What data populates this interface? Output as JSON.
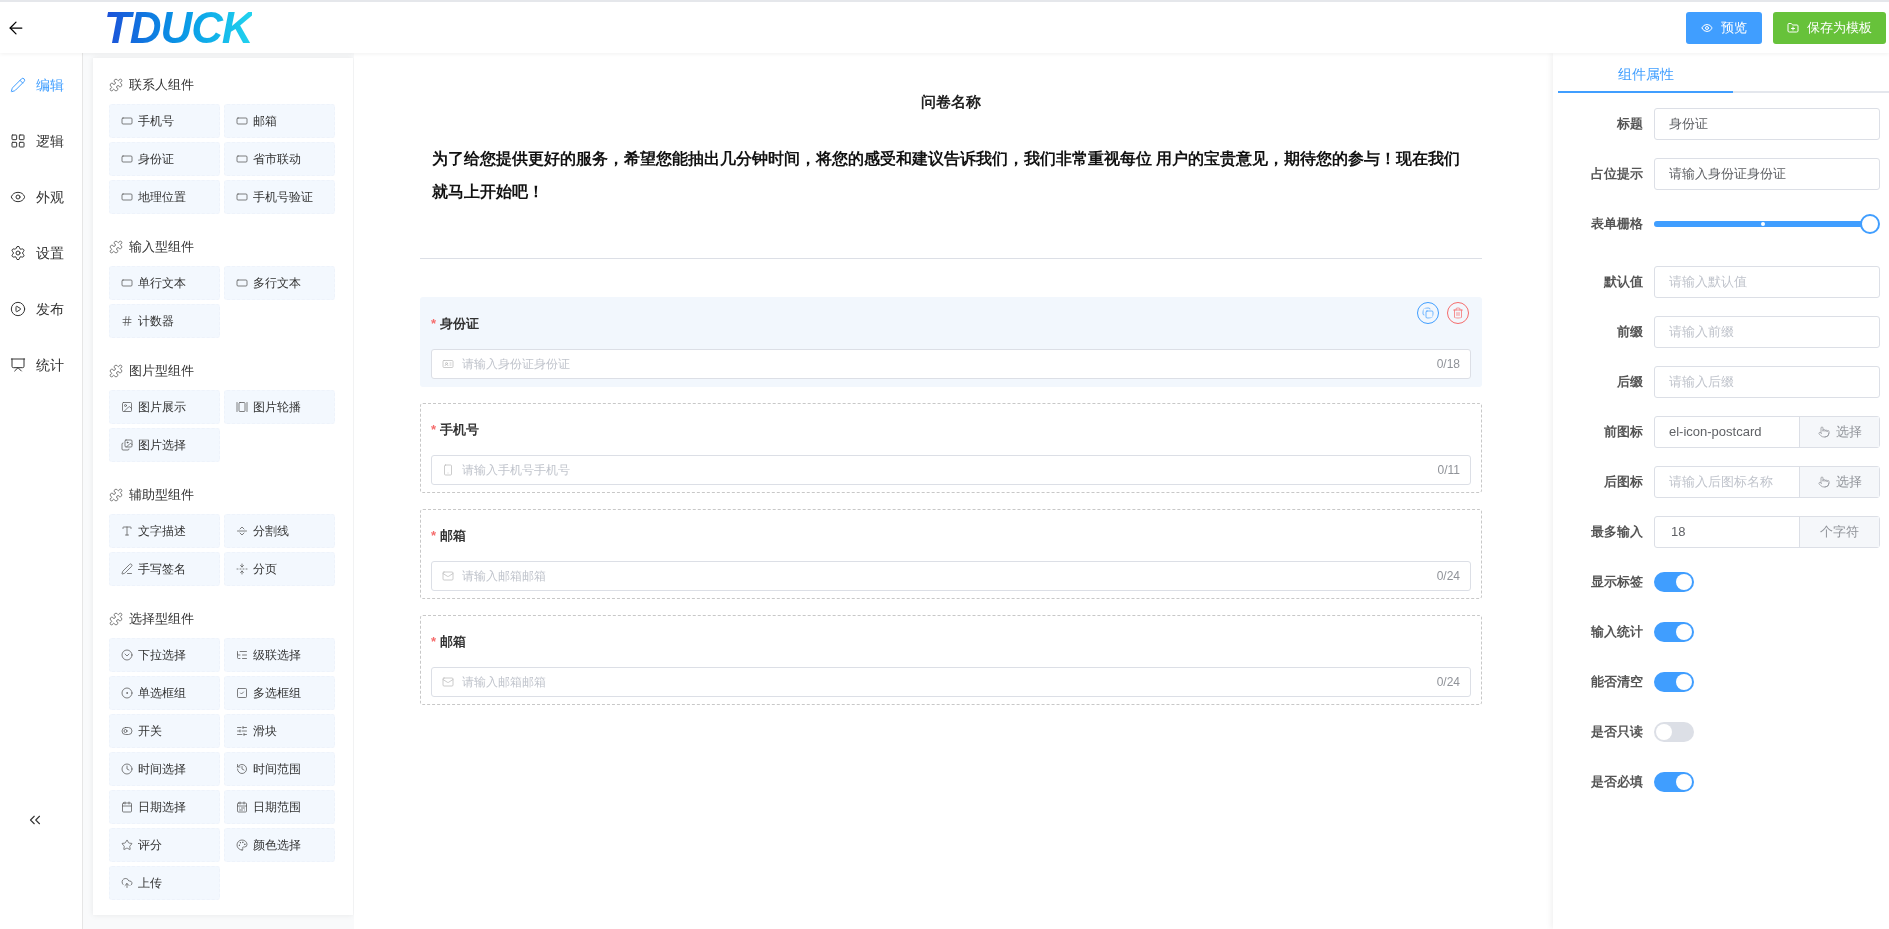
{
  "header": {
    "logo": "TDUCK",
    "buttons": [
      {
        "kind": "preview",
        "label": "预览"
      },
      {
        "kind": "save",
        "label": "保存为模板"
      }
    ]
  },
  "nav": [
    {
      "label": "编辑",
      "selected": true
    },
    {
      "label": "逻辑",
      "selected": false
    },
    {
      "label": "外观",
      "selected": false
    },
    {
      "label": "设置",
      "selected": false
    },
    {
      "label": "发布",
      "selected": false
    },
    {
      "label": "统计",
      "selected": false
    }
  ],
  "palette": [
    {
      "title": "联系人组件",
      "items": [
        "手机号",
        "邮箱",
        "身份证",
        "省市联动",
        "地理位置",
        "手机号验证"
      ]
    },
    {
      "title": "输入型组件",
      "items": [
        "单行文本",
        "多行文本",
        "计数器"
      ]
    },
    {
      "title": "图片型组件",
      "items": [
        "图片展示",
        "图片轮播",
        "图片选择"
      ]
    },
    {
      "title": "辅助型组件",
      "items": [
        "文字描述",
        "分割线",
        "手写签名",
        "分页"
      ]
    },
    {
      "title": "选择型组件",
      "items": [
        "下拉选择",
        "级联选择",
        "单选框组",
        "多选框组",
        "开关",
        "滑块",
        "时间选择",
        "时间范围",
        "日期选择",
        "日期范围",
        "评分",
        "颜色选择",
        "上传"
      ]
    }
  ],
  "form": {
    "title": "问卷名称",
    "required_mark": "*",
    "description": "为了给您提供更好的服务，希望您能抽出几分钟时间，将您的感受和建议告诉我们，我们非常重视每位 用户的宝贵意见，期待您的参与！现在我们就马上开始吧！",
    "fields": [
      {
        "label": "身份证",
        "required": true,
        "placeholder": "请输入身份证身份证",
        "count": "0/18",
        "selected": true
      },
      {
        "label": "手机号",
        "required": true,
        "placeholder": "请输入手机号手机号",
        "count": "0/11",
        "selected": false
      },
      {
        "label": "邮箱",
        "required": true,
        "placeholder": "请输入邮箱邮箱",
        "count": "0/24",
        "selected": false
      },
      {
        "label": "邮箱",
        "required": true,
        "placeholder": "请输入邮箱邮箱",
        "count": "0/24",
        "selected": false
      }
    ]
  },
  "properties": {
    "tab": "组件属性",
    "rows": [
      {
        "kind": "input",
        "label": "标题",
        "value": "身份证"
      },
      {
        "kind": "input",
        "label": "占位提示",
        "value": "请输入身份证身份证"
      },
      {
        "kind": "slider",
        "label": "表单栅格",
        "level": 1
      },
      {
        "kind": "input",
        "label": "默认值",
        "placeholder": "请输入默认值"
      },
      {
        "kind": "input",
        "label": "前缀",
        "placeholder": "请输入前缀"
      },
      {
        "kind": "input",
        "label": "后缀",
        "placeholder": "请输入后缀"
      },
      {
        "kind": "pick",
        "label": "前图标",
        "value": "el-icon-postcard",
        "button": "选择"
      },
      {
        "kind": "pick",
        "label": "后图标",
        "placeholder": "请输入后图标名称",
        "button": "选择"
      },
      {
        "kind": "append",
        "label": "最多输入",
        "value": "18",
        "append": "个字符"
      },
      {
        "kind": "switch",
        "label": "显示标签",
        "on": true
      },
      {
        "kind": "switch",
        "label": "输入统计",
        "on": true
      },
      {
        "kind": "switch",
        "label": "能否清空",
        "on": true
      },
      {
        "kind": "switch",
        "label": "是否只读",
        "on": false
      },
      {
        "kind": "switch",
        "label": "是否必填",
        "on": true
      }
    ]
  }
}
